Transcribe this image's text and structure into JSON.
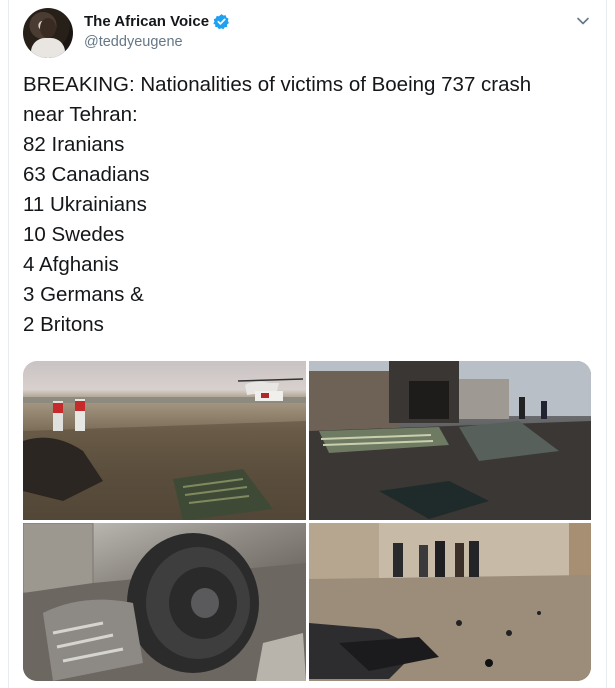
{
  "tweet": {
    "author": {
      "display_name": "The African Voice",
      "handle": "@teddyeugene",
      "verified": true
    },
    "text_lines": [
      "BREAKING: Nationalities of victims of Boeing 737 crash",
      "near Tehran:",
      "82 Iranians",
      "63 Canadians",
      "11 Ukrainians",
      "10 Swedes",
      "4 Afghanis",
      "3 Germans &",
      "2 Britons"
    ],
    "media": {
      "photos": [
        "crash-site-rescue-workers-helicopter",
        "wreckage-near-wall-people-searching",
        "jet-engine-debris",
        "investigators-walking-among-debris"
      ]
    }
  },
  "colors": {
    "primary_text": "#14171a",
    "secondary_text": "#657786",
    "verified_blue": "#1da1f2",
    "border": "#e6ecf0"
  }
}
